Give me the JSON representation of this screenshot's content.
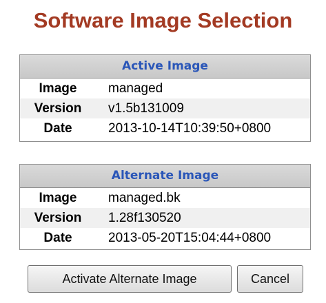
{
  "title": "Software Image Selection",
  "active": {
    "header": "Active Image",
    "rows": [
      {
        "label": "Image",
        "value": "managed"
      },
      {
        "label": "Version",
        "value": "v1.5b131009"
      },
      {
        "label": "Date",
        "value": "2013-10-14T10:39:50+0800"
      }
    ]
  },
  "alternate": {
    "header": "Alternate Image",
    "rows": [
      {
        "label": "Image",
        "value": "managed.bk"
      },
      {
        "label": "Version",
        "value": "1.28f130520"
      },
      {
        "label": "Date",
        "value": "2013-05-20T15:04:44+0800"
      }
    ]
  },
  "buttons": {
    "activate_label": "Activate Alternate Image",
    "cancel_label": "Cancel"
  },
  "colors": {
    "title": "#a33a23",
    "header_text": "#2a56b8",
    "header_bg": "#d0d0d0"
  }
}
